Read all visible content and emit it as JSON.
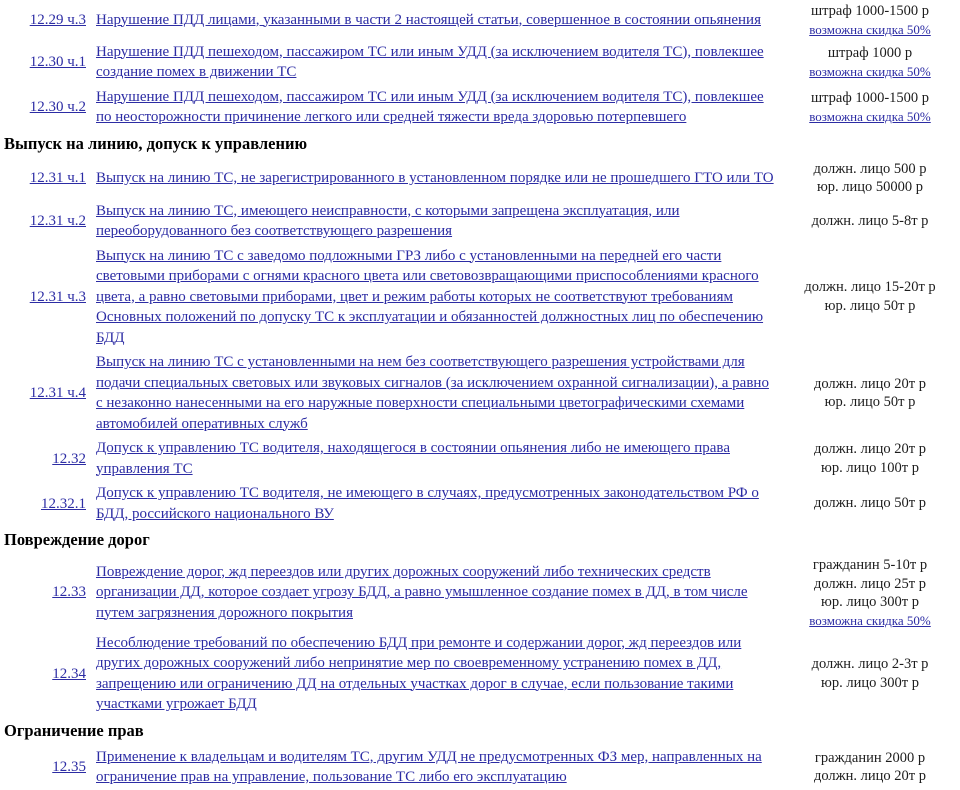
{
  "document": {
    "language": "ru",
    "link_color": "#2c2ca4",
    "text_color": "#1c1c1c",
    "background": "#ffffff"
  },
  "rows": [
    {
      "kind": "entry",
      "article": "12.29 ч.3",
      "description": "Нарушение ПДД лицами, указанными в части 2 настоящей статьи, совершенное в состоянии опьянения",
      "penalty_lines": [
        "штраф 1000-1500 р"
      ],
      "discount": "возможна скидка 50%"
    },
    {
      "kind": "entry",
      "article": "12.30 ч.1",
      "description": "Нарушение ПДД пешеходом, пассажиром ТС или иным УДД (за исключением водителя ТС), повлекшее создание помех в движении ТС",
      "penalty_lines": [
        "штраф 1000 р"
      ],
      "discount": "возможна скидка 50%"
    },
    {
      "kind": "entry",
      "article": "12.30 ч.2",
      "description": "Нарушение ПДД пешеходом, пассажиром ТС или иным УДД (за исключением водителя ТС), повлекшее по неосторожности причинение легкого или средней тяжести вреда здоровью потерпевшего",
      "penalty_lines": [
        "штраф 1000-1500 р"
      ],
      "discount": "возможна скидка 50%"
    },
    {
      "kind": "section",
      "title": "Выпуск на линию, допуск к управлению"
    },
    {
      "kind": "entry",
      "article": "12.31 ч.1",
      "description": "Выпуск на линию ТС, не зарегистрированного в установленном порядке или не прошедшего ГТО или ТО",
      "penalty_lines": [
        "должн. лицо 500 р",
        "юр. лицо 50000 р"
      ],
      "discount": ""
    },
    {
      "kind": "entry",
      "article": "12.31 ч.2",
      "description": "Выпуск на линию ТС, имеющего неисправности, с которыми запрещена эксплуатация, или переоборудованного без соответствующего разрешения",
      "penalty_lines": [
        "должн. лицо 5-8т р"
      ],
      "discount": ""
    },
    {
      "kind": "entry",
      "article": "12.31 ч.3",
      "description": "Выпуск на линию ТС с заведомо подложными ГРЗ либо с установленными на передней его части световыми приборами с огнями красного цвета или световозвращающими приспособлениями красного цвета, а равно световыми приборами, цвет и режим работы которых не соответствуют требованиям Основных положений по допуску ТС к эксплуатации и обязанностей должностных лиц по обеспечению БДД",
      "penalty_lines": [
        "должн. лицо 15-20т р",
        "юр. лицо 50т р"
      ],
      "discount": ""
    },
    {
      "kind": "entry",
      "article": "12.31 ч.4",
      "description": "Выпуск на линию ТС с установленными на нем без соответствующего разрешения устройствами для подачи специальных световых или звуковых сигналов (за исключением охранной сигнализации), а равно с незаконно нанесенными на его наружные поверхности специальными цветографическими схемами автомобилей оперативных служб",
      "penalty_lines": [
        "должн. лицо 20т р",
        "юр. лицо 50т р"
      ],
      "discount": ""
    },
    {
      "kind": "entry",
      "article": "12.32",
      "description": "Допуск к управлению ТС водителя, находящегося в состоянии опьянения либо не имеющего права управления ТС",
      "penalty_lines": [
        "должн. лицо 20т р",
        "юр. лицо 100т р"
      ],
      "discount": ""
    },
    {
      "kind": "entry",
      "article": "12.32.1",
      "description": "Допуск к управлению ТС водителя, не имеющего в случаях, предусмотренных законодательством РФ о БДД, российского национального ВУ",
      "penalty_lines": [
        "должн. лицо 50т р"
      ],
      "discount": ""
    },
    {
      "kind": "section",
      "title": "Повреждение дорог"
    },
    {
      "kind": "entry",
      "article": "12.33",
      "description": "Повреждение дорог, жд переездов или других дорожных сооружений либо технических средств организации ДД, которое создает угрозу БДД, а равно умышленное создание помех в ДД, в том числе путем загрязнения дорожного покрытия",
      "penalty_lines": [
        "гражданин 5-10т р",
        "должн. лицо 25т р",
        "юр. лицо 300т р"
      ],
      "discount": "возможна скидка 50%"
    },
    {
      "kind": "entry",
      "article": "12.34",
      "description": "Несоблюдение требований по обеспечению БДД при ремонте и содержании дорог, жд переездов или других дорожных сооружений либо непринятие мер по своевременному устранению помех в ДД, запрещению или ограничению ДД на отдельных участках дорог в случае, если пользование такими участками угрожает БДД",
      "penalty_lines": [
        "должн. лицо 2-3т р",
        "юр. лицо 300т р"
      ],
      "discount": ""
    },
    {
      "kind": "section",
      "title": "Ограничение прав"
    },
    {
      "kind": "entry",
      "article": "12.35",
      "description": "Применение к владельцам и водителям ТС, другим УДД не предусмотренных ФЗ мер, направленных на ограничение прав на управление, пользование ТС либо его эксплуатацию",
      "penalty_lines": [
        "гражданин 2000 р",
        "должн. лицо 20т р"
      ],
      "discount": ""
    }
  ]
}
